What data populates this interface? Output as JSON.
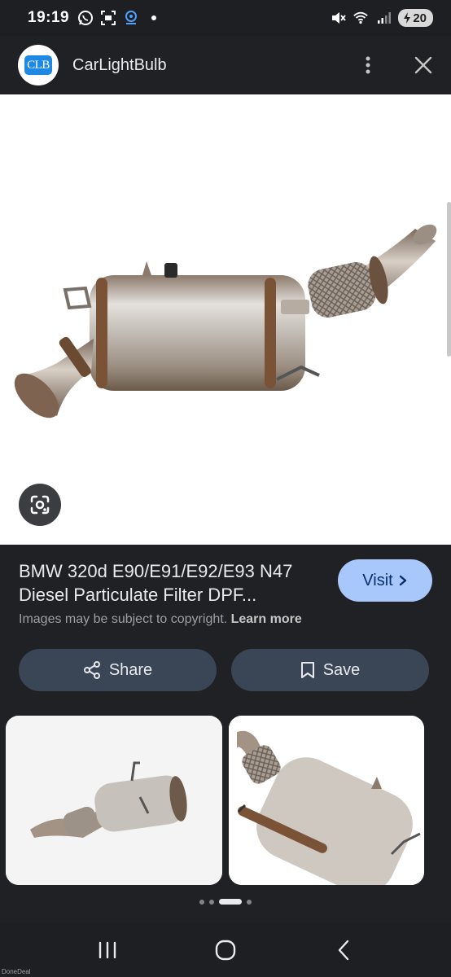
{
  "status_bar": {
    "time": "19:19",
    "battery": "20",
    "icons_left": [
      "whatsapp-icon",
      "screen-record-icon",
      "location-icon",
      "dot-icon"
    ],
    "icons_right": [
      "mute-icon",
      "wifi-6e-icon",
      "signal-icon",
      "battery-icon"
    ]
  },
  "app_bar": {
    "logo_text": "CLB",
    "site_name": "CarLightBulb"
  },
  "result": {
    "title": "BMW 320d E90/E91/E92/E93 N47 Diesel Particulate Filter DPF...",
    "visit_label": "Visit",
    "copyright_text": "Images may be subject to copyright.",
    "learn_more": "Learn more",
    "share_label": "Share",
    "save_label": "Save"
  },
  "pager": {
    "count": 4,
    "active": 2
  },
  "nav": [
    "recents-button",
    "home-button",
    "back-button"
  ],
  "watermark": "DoneDeal",
  "colors": {
    "background": "#202124",
    "visit_button": "#a8c7fa",
    "pill_button": "#3a4656",
    "text": "#e8eaed",
    "muted": "#9aa0a6"
  }
}
